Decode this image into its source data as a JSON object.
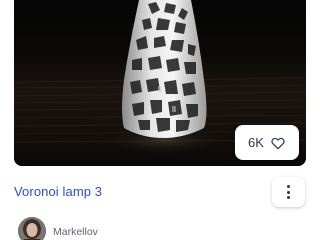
{
  "card": {
    "title": "Voronoi lamp 3",
    "author": "Markellov",
    "likes": "6K",
    "colors": {
      "title": "#2d4bd6",
      "text": "#2d3552",
      "secondary": "#5f6472",
      "background": "#ffffff"
    },
    "icons": {
      "like": "heart-outline-icon",
      "more": "kebab-menu-icon"
    }
  }
}
